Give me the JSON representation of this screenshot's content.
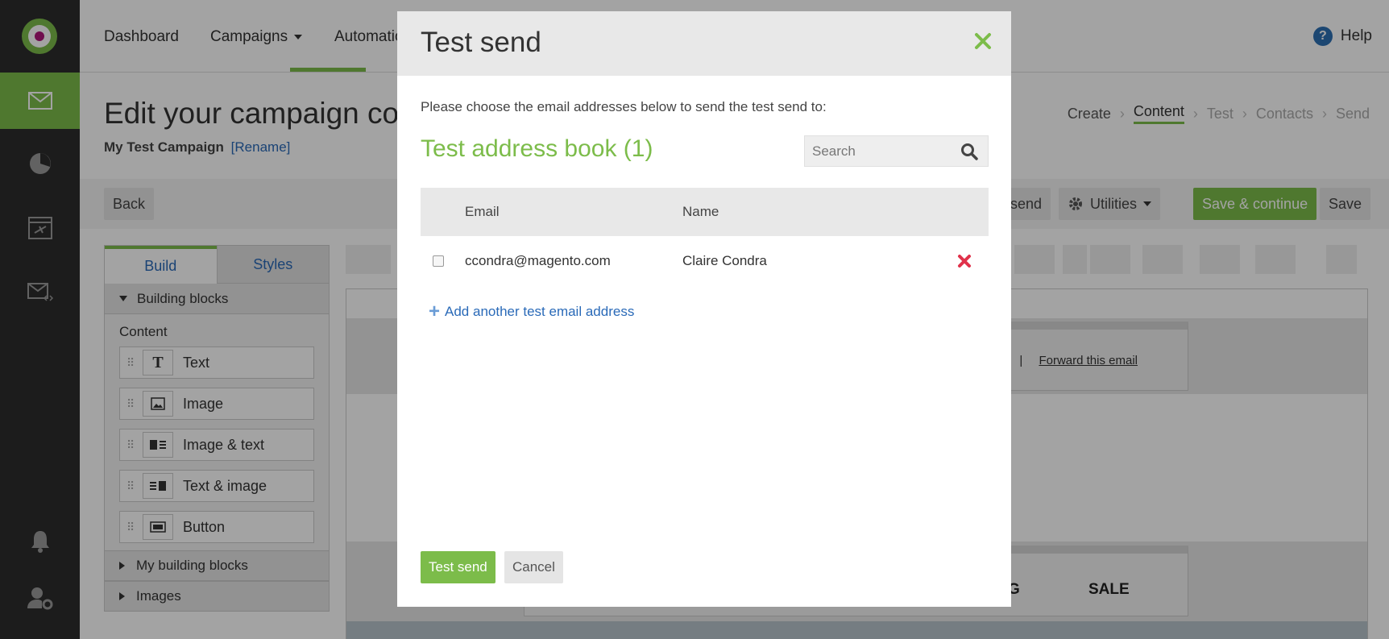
{
  "nav": {
    "dashboard": "Dashboard",
    "campaigns": "Campaigns",
    "automation": "Automatio",
    "help": "Help"
  },
  "page": {
    "title": "Edit your campaign co",
    "campaign_name": "My Test Campaign",
    "rename": "[Rename]"
  },
  "steps": [
    "Create",
    "Content",
    "Test",
    "Contacts",
    "Send"
  ],
  "toolbar": {
    "back": "Back",
    "test_send_partial": "send",
    "utilities": "Utilities",
    "save_continue": "Save & continue",
    "save": "Save"
  },
  "left_panel": {
    "tab_build": "Build",
    "tab_styles": "Styles",
    "building_blocks": "Building blocks",
    "content_label": "Content",
    "blocks": [
      "Text",
      "Image",
      "Image & text",
      "Text & image",
      "Button"
    ],
    "my_building_blocks": "My building blocks",
    "images": "Images"
  },
  "editor": {
    "link_partial": "r",
    "forward": "Forward this email",
    "sale": "SALE",
    "partial_g": "G"
  },
  "modal": {
    "title": "Test send",
    "intro": "Please choose the email addresses below to send the test send to:",
    "address_book": "Test address book (1)",
    "search_placeholder": "Search",
    "col_email": "Email",
    "col_name": "Name",
    "rows": [
      {
        "email": "ccondra@magento.com",
        "name": "Claire Condra"
      }
    ],
    "add_link": "Add another test email address",
    "test_send": "Test send",
    "cancel": "Cancel"
  },
  "colors": {
    "accent": "#7cbc4a",
    "link": "#2a6ab8",
    "rail": "#2c2c2c",
    "delete": "#e0324b"
  }
}
